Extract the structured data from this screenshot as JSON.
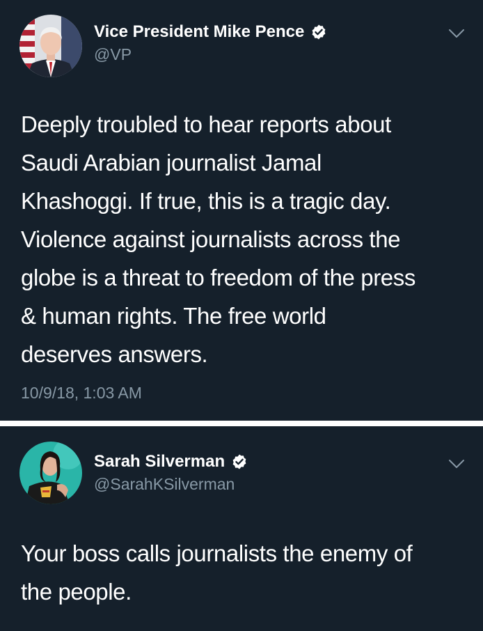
{
  "theme": {
    "background": "#15202b",
    "text": "#ffffff",
    "secondary_text": "#8899a6",
    "divider": "#ffffff",
    "verified_badge": "#ffffff"
  },
  "tweets": [
    {
      "display_name": "Vice President Mike Pence",
      "handle": "@VP",
      "verified": true,
      "avatar_icon": "avatar-photo",
      "menu_icon": "chevron-down-icon",
      "text": "Deeply troubled to hear reports about\nSaudi Arabian journalist Jamal\nKhashoggi. If true, this is a tragic day.\nViolence against journalists across the\nglobe is a threat to freedom of the press\n& human rights. The free world\ndeserves answers.",
      "timestamp": "10/9/18, 1:03 AM"
    },
    {
      "display_name": "Sarah Silverman",
      "handle": "@SarahKSilverman",
      "verified": true,
      "avatar_icon": "avatar-photo",
      "menu_icon": "chevron-down-icon",
      "text": "Your boss calls journalists the enemy of\nthe people."
    }
  ]
}
